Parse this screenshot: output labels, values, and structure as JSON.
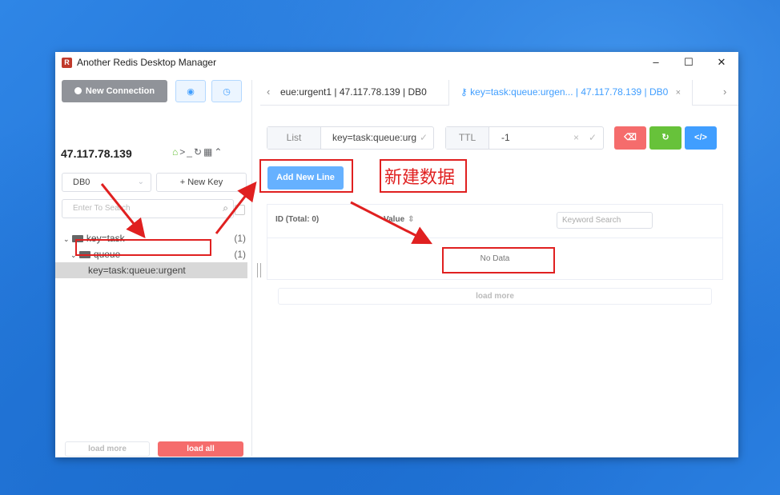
{
  "window": {
    "title": "Another Redis Desktop Manager",
    "minimize": "–",
    "maximize": "☐",
    "close": "✕"
  },
  "sidebar": {
    "new_connection": "New Connection",
    "connection_name": "47.117.78.139",
    "db_select": "DB0",
    "new_key": "+ New Key",
    "search_placeholder": "Enter To Search",
    "tree": [
      {
        "label": "key=task",
        "count": "(1)",
        "expanded": true
      },
      {
        "label": "queue",
        "count": "(1)",
        "expanded": true
      },
      {
        "label": "key=task:queue:urgent",
        "selected": true
      }
    ],
    "load_more": "load more",
    "load_all": "load all"
  },
  "tabs": [
    {
      "label": "eue:urgent1 | 47.117.78.139 | DB0",
      "active": false
    },
    {
      "label": "key=task:queue:urgen... | 47.117.78.139 | DB0",
      "active": true
    }
  ],
  "key_detail": {
    "type": "List",
    "key_name": "key=task:queue:urg",
    "ttl_label": "TTL",
    "ttl_value": "-1",
    "add_new_line": "Add New Line",
    "table": {
      "col_id": "ID (Total: 0)",
      "col_value": "Value",
      "keyword_placeholder": "Keyword Search",
      "empty_text": "No Data"
    },
    "load_more": "load more"
  },
  "annotation_text": "新建数据",
  "colors": {
    "primary": "#409eff",
    "danger": "#f56c6c",
    "success": "#67c23a",
    "annotation": "#e02020"
  }
}
